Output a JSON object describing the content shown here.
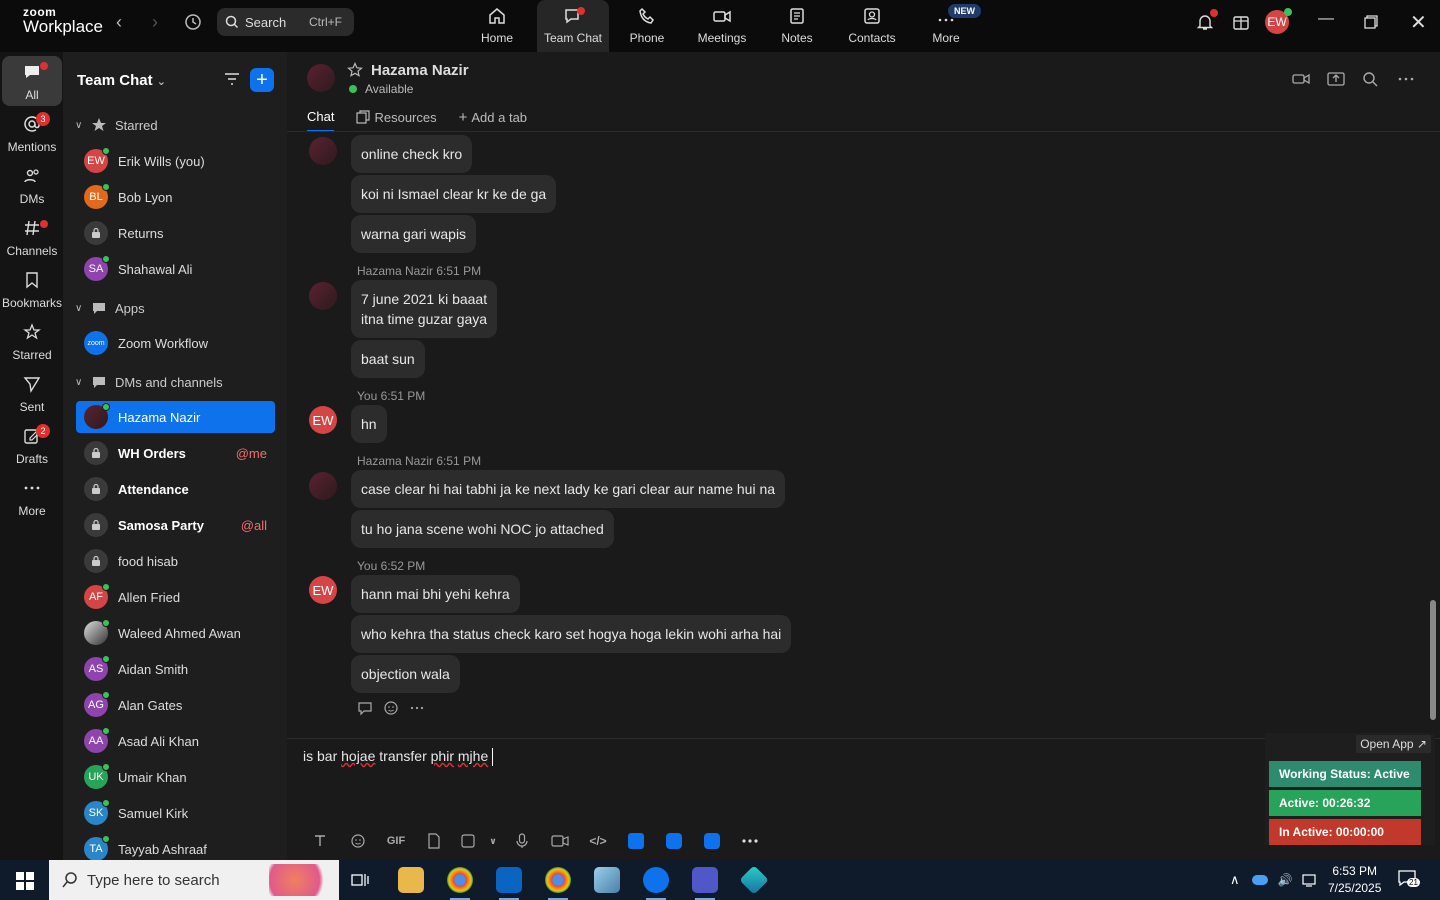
{
  "app": {
    "logo_top": "zoom",
    "logo_bottom": "Workplace",
    "search_label": "Search",
    "search_shortcut": "Ctrl+F",
    "user_initials": "EW"
  },
  "topnav": [
    {
      "label": "Home"
    },
    {
      "label": "Team Chat"
    },
    {
      "label": "Phone"
    },
    {
      "label": "Meetings"
    },
    {
      "label": "Notes"
    },
    {
      "label": "Contacts"
    },
    {
      "label": "More",
      "badge": "NEW"
    }
  ],
  "rail": [
    {
      "label": "All"
    },
    {
      "label": "Mentions",
      "badge": "3"
    },
    {
      "label": "DMs"
    },
    {
      "label": "Channels"
    },
    {
      "label": "Bookmarks"
    },
    {
      "label": "Starred"
    },
    {
      "label": "Sent"
    },
    {
      "label": "Drafts",
      "badge": "2"
    },
    {
      "label": "More"
    }
  ],
  "sidebar": {
    "title": "Team Chat",
    "sections": {
      "starred": "Starred",
      "apps": "Apps",
      "dms": "DMs and channels"
    },
    "starred": [
      {
        "initials": "EW",
        "name": "Erik Wills (you)",
        "color": "#d64545"
      },
      {
        "initials": "BL",
        "name": "Bob Lyon",
        "color": "#e36a1c"
      },
      {
        "initials": "",
        "name": "Returns",
        "color": ""
      },
      {
        "initials": "SA",
        "name": "Shahawal Ali",
        "color": "#8e44ad"
      }
    ],
    "apps": [
      {
        "initials": "zoom",
        "name": "Zoom Workflow",
        "color": "#0e72ed"
      }
    ],
    "dms": [
      {
        "initials": "",
        "name": "Hazama Nazir",
        "mention": ""
      },
      {
        "initials": "",
        "name": "WH Orders",
        "mention": "@me"
      },
      {
        "initials": "",
        "name": "Attendance",
        "mention": ""
      },
      {
        "initials": "",
        "name": "Samosa Party",
        "mention": "@all"
      },
      {
        "initials": "",
        "name": "food hisab",
        "mention": ""
      },
      {
        "initials": "AF",
        "name": "Allen Fried",
        "color": "#d64545"
      },
      {
        "initials": "",
        "name": "Waleed Ahmed Awan",
        "color": ""
      },
      {
        "initials": "AS",
        "name": "Aidan Smith",
        "color": "#8e44ad"
      },
      {
        "initials": "AG",
        "name": "Alan Gates",
        "color": "#8e44ad"
      },
      {
        "initials": "AA",
        "name": "Asad Ali Khan",
        "color": "#8e44ad"
      },
      {
        "initials": "UK",
        "name": "Umair Khan",
        "color": "#27a35a"
      },
      {
        "initials": "SK",
        "name": "Samuel Kirk",
        "color": "#2a86c9"
      },
      {
        "initials": "TA",
        "name": "Tayyab Ashraaf",
        "color": "#2a86c9"
      }
    ]
  },
  "channel": {
    "name": "Hazama Nazir",
    "status": "Available",
    "tabs": [
      "Chat",
      "Resources",
      "Add a tab"
    ]
  },
  "messages": {
    "b1": "online check kro",
    "b2": "koi ni Ismael clear kr ke de ga",
    "b3": "warna gari wapis",
    "meta1_name": "Hazama Nazir",
    "meta1_time": "6:51 PM",
    "b4_line1": "7 june 2021 ki baaat",
    "b4_line2": "itna time guzar gaya",
    "b5": "baat sun",
    "meta2_name": "You",
    "meta2_time": "6:51 PM",
    "b6": "hn",
    "meta3_name": "Hazama Nazir",
    "meta3_time": "6:51 PM",
    "b7": "case clear hi hai tabhi ja ke next lady ke gari clear aur name hui na",
    "b8": "tu ho jana scene wohi NOC jo attached",
    "meta4_name": "You",
    "meta4_time": "6:52 PM",
    "b9": "hann mai bhi yehi kehra",
    "b10": "who kehra tha status check karo set hogya hoga lekin wohi arha hai",
    "b11": "objection wala",
    "my_initials": "EW"
  },
  "composer": {
    "w1": "is bar ",
    "w2": "hojae",
    "w3": " transfer ",
    "w4": "phir",
    "w5": " ",
    "w6": "mjhe",
    "gif": "GIF"
  },
  "widget": {
    "open_app": "Open App ↗",
    "working_status": "Working Status: Active",
    "active": "Active: 00:26:32",
    "inactive": "In Active: 00:00:00",
    "colors": {
      "working": "#2e8b6e",
      "active": "#27a35a",
      "inactive": "#c0392b"
    }
  },
  "taskbar": {
    "search_placeholder": "Type here to search",
    "time": "6:53 PM",
    "date": "7/25/2025",
    "notif_count": "21"
  }
}
